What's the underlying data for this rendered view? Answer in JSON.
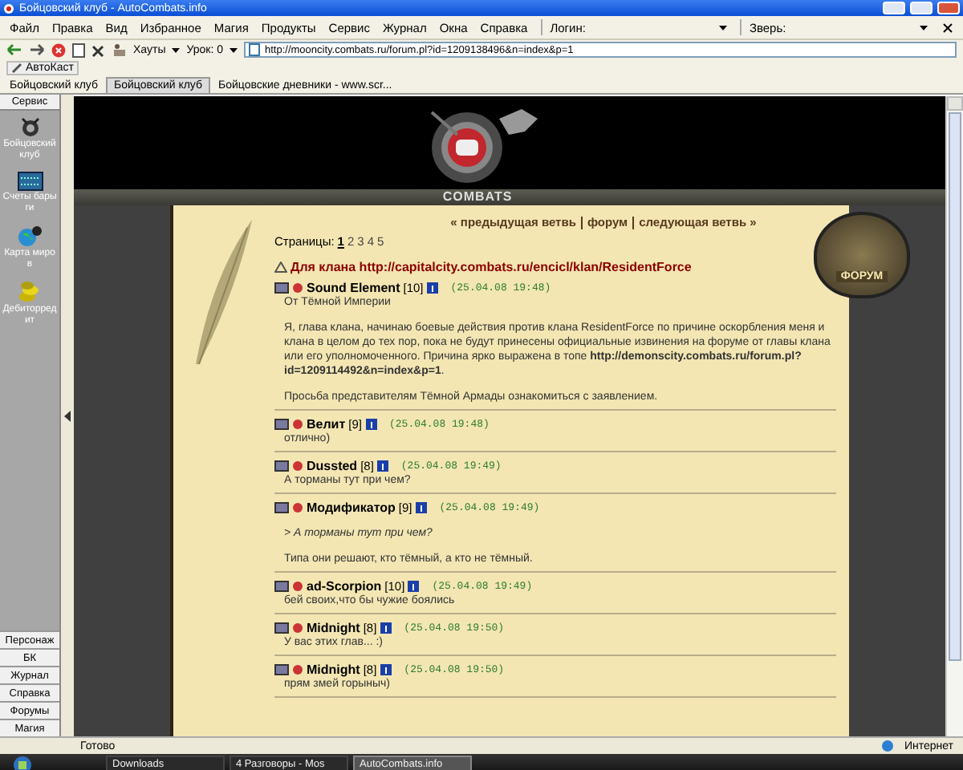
{
  "window": {
    "title": "Бойцовский клуб - AutoCombats.info"
  },
  "menu": [
    "Файл",
    "Правка",
    "Вид",
    "Избранное",
    "Магия",
    "Продукты",
    "Сервис",
    "Журнал",
    "Окна",
    "Справка"
  ],
  "login": {
    "label": "Логин:"
  },
  "beast": {
    "label": "Зверь:"
  },
  "toolbar": {
    "hauty": "Хауты",
    "level": "Урок: 0",
    "address": "http://mooncity.combats.ru/forum.pl?id=1209138496&n=index&p=1"
  },
  "autocast": "АвтоКаст",
  "tabs": [
    {
      "label": "Бойцовский клуб",
      "selected": false
    },
    {
      "label": "Бойцовский клуб",
      "selected": true
    },
    {
      "label": "Бойцовские дневники - www.scr...",
      "selected": false
    }
  ],
  "sidebar": {
    "header": "Сервис",
    "items": [
      {
        "label": "Бойцовский клуб",
        "kind": "emblem"
      },
      {
        "label": "Счеты барыги",
        "kind": "abacus"
      },
      {
        "label": "Карта миров",
        "kind": "globe"
      },
      {
        "label": "Дебиторредит",
        "kind": "coins"
      }
    ],
    "buttons": [
      "Персонаж",
      "БК",
      "Журнал",
      "Справка",
      "Форумы",
      "Магия"
    ]
  },
  "site": {
    "logo": "COMBATS",
    "badge": "ФОРУМ"
  },
  "forum": {
    "nav": [
      "« предыдущая ветвь",
      "форум",
      "следующая ветвь »"
    ],
    "pages_label": "Страницы:",
    "pages": [
      {
        "label": "1",
        "selected": true
      },
      {
        "label": "2",
        "selected": false
      },
      {
        "label": "3",
        "selected": false
      },
      {
        "label": "4",
        "selected": false
      },
      {
        "label": "5",
        "selected": false
      }
    ],
    "topic": "Для клана http://capitalcity.combats.ru/encicl/klan/ResidentForce",
    "posts": [
      {
        "author": "Sound Element",
        "level": "[10]",
        "date": "(25.04.08 19:48)",
        "paragraphs": [
          {
            "kind": "plain",
            "text": "От Тёмной Империи"
          },
          {
            "kind": "plain",
            "text": "Я, глава клана, начинаю боевые действия против клана ResidentForce по причине оскорбления меня и клана в целом до тех пор, пока не будут принесены официальные извинения на форуме от главы клана или его уполномоченного. Причина ярко выражена в топе **http://demonscity.combats.ru/forum.pl?id=1209114492&n=index&p=1**."
          },
          {
            "kind": "plain",
            "text": "Просьба представителям Тёмной Армады ознакомиться с заявлением."
          }
        ]
      },
      {
        "author": "Велит",
        "level": "[9]",
        "date": "(25.04.08 19:48)",
        "paragraphs": [
          {
            "kind": "plain",
            "text": "отлично)"
          }
        ]
      },
      {
        "author": "Dussted",
        "level": "[8]",
        "date": "(25.04.08 19:49)",
        "paragraphs": [
          {
            "kind": "plain",
            "text": "А торманы тут при чем?"
          }
        ]
      },
      {
        "author": "Модификатор",
        "level": "[9]",
        "date": "(25.04.08 19:49)",
        "paragraphs": [
          {
            "kind": "quote",
            "text": "> А торманы тут при чем?"
          },
          {
            "kind": "plain",
            "text": "Типа они решают, кто тёмный, а кто не тёмный."
          }
        ]
      },
      {
        "author": "ad-Scorpion",
        "level": "[10]",
        "date": "(25.04.08 19:49)",
        "paragraphs": [
          {
            "kind": "plain",
            "text": "бей своих,что бы чужие боялись"
          }
        ]
      },
      {
        "author": "Midnight",
        "level": "[8]",
        "date": "(25.04.08 19:50)",
        "paragraphs": [
          {
            "kind": "plain",
            "text": "У вас этих глав... :)"
          }
        ]
      },
      {
        "author": "Midnight",
        "level": "[8]",
        "date": "(25.04.08 19:50)",
        "paragraphs": [
          {
            "kind": "plain",
            "text": "прям змей горыныч)"
          }
        ]
      }
    ]
  },
  "status_bar": {
    "text": "Готово",
    "zone": "Интернет"
  },
  "taskbar": {
    "tasks": [
      {
        "label": "Downloads",
        "selected": false
      },
      {
        "label": "4 Разговоры - Mos",
        "selected": false
      },
      {
        "label": "AutoCombats.info",
        "selected": true
      }
    ]
  }
}
